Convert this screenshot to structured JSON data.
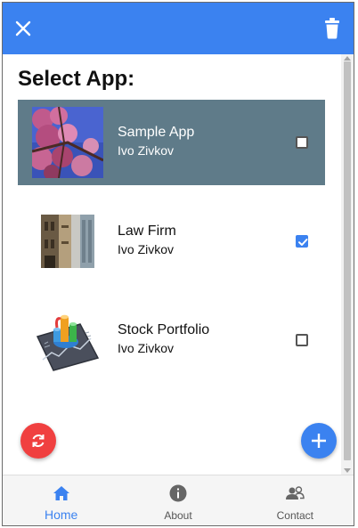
{
  "header": {
    "close_icon": "close-icon",
    "delete_icon": "trash-icon",
    "accent_color": "#3b82f0"
  },
  "main": {
    "title": "Select App:",
    "apps": [
      {
        "name": "Sample App",
        "author": "Ivo Zivkov",
        "checked": false,
        "highlighted": true,
        "thumbnail": "blossom-photo"
      },
      {
        "name": "Law Firm",
        "author": "Ivo Zivkov",
        "checked": true,
        "highlighted": false,
        "thumbnail": "building-photo"
      },
      {
        "name": "Stock Portfolio",
        "author": "Ivo Zivkov",
        "checked": false,
        "highlighted": false,
        "thumbnail": "chart-graphic"
      }
    ],
    "refresh_icon": "refresh-icon",
    "add_icon": "plus-icon"
  },
  "bottom_nav": {
    "items": [
      {
        "label": "Home",
        "icon": "home-icon",
        "active": true
      },
      {
        "label": "About",
        "icon": "info-icon",
        "active": false
      },
      {
        "label": "Contact",
        "icon": "contacts-icon",
        "active": false
      }
    ]
  }
}
